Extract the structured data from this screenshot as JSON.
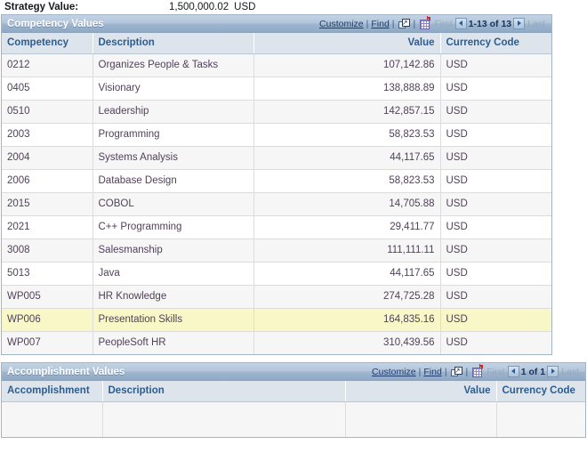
{
  "summary": {
    "label": "Strategy Value:",
    "amount": "1,500,000.02",
    "currency": "USD"
  },
  "toolbar": {
    "customize_label": "Customize",
    "find_label": "Find",
    "separator": "|",
    "expand_icon": "view-all-expand-icon",
    "download_icon": "download-to-spreadsheet-icon",
    "first_label": "First",
    "last_label": "Last",
    "prev_icon": "previous-page-arrow-icon",
    "next_icon": "next-page-arrow-icon"
  },
  "competency_grid": {
    "title": "Competency Values",
    "row_range": "1-13 of 13",
    "columns": [
      "Competency",
      "Description",
      "",
      "Value",
      "Currency Code"
    ],
    "headers": {
      "code": "Competency",
      "description": "Description",
      "blank": "",
      "value": "Value",
      "currency": "Currency Code"
    },
    "rows": [
      {
        "code": "0212",
        "description": "Organizes People & Tasks",
        "value": "107,142.86",
        "currency": "USD",
        "selected": false
      },
      {
        "code": "0405",
        "description": "Visionary",
        "value": "138,888.89",
        "currency": "USD",
        "selected": false
      },
      {
        "code": "0510",
        "description": "Leadership",
        "value": "142,857.15",
        "currency": "USD",
        "selected": false
      },
      {
        "code": "2003",
        "description": "Programming",
        "value": "58,823.53",
        "currency": "USD",
        "selected": false
      },
      {
        "code": "2004",
        "description": "Systems Analysis",
        "value": "44,117.65",
        "currency": "USD",
        "selected": false
      },
      {
        "code": "2006",
        "description": "Database Design",
        "value": "58,823.53",
        "currency": "USD",
        "selected": false
      },
      {
        "code": "2015",
        "description": "COBOL",
        "value": "14,705.88",
        "currency": "USD",
        "selected": false
      },
      {
        "code": "2021",
        "description": "C++ Programming",
        "value": "29,411.77",
        "currency": "USD",
        "selected": false
      },
      {
        "code": "3008",
        "description": "Salesmanship",
        "value": "111,111.11",
        "currency": "USD",
        "selected": false
      },
      {
        "code": "5013",
        "description": "Java",
        "value": "44,117.65",
        "currency": "USD",
        "selected": false
      },
      {
        "code": "WP005",
        "description": "HR Knowledge",
        "value": "274,725.28",
        "currency": "USD",
        "selected": false
      },
      {
        "code": "WP006",
        "description": "Presentation Skills",
        "value": "164,835.16",
        "currency": "USD",
        "selected": true
      },
      {
        "code": "WP007",
        "description": "PeopleSoft HR",
        "value": "310,439.56",
        "currency": "USD",
        "selected": false
      }
    ]
  },
  "accomplishment_grid": {
    "title": "Accomplishment Values",
    "row_range": "1 of 1",
    "headers": {
      "code": "Accomplishment",
      "description": "Description",
      "blank": "",
      "value": "Value",
      "currency": "Currency Code"
    },
    "rows": [
      {
        "code": "",
        "description": "",
        "value": "",
        "currency": "",
        "selected": false
      }
    ]
  },
  "colors": {
    "header_bar_top": "#c3d3e4",
    "header_bar_bottom": "#8fa9c5",
    "column_header_bg": "#dde4ec",
    "column_header_text": "#2b5d91",
    "row_odd": "#f6f6f6",
    "row_even": "#ffffff",
    "row_selected": "#f7f7c8",
    "cell_text": "#514159",
    "link": "#1f3b6e",
    "grid_border": "#a3b4c6"
  }
}
